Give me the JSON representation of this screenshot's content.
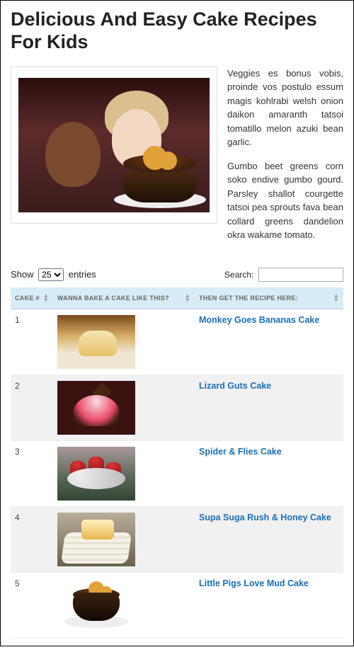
{
  "title": "Delicious And Easy Cake Recipes For Kids",
  "intro": {
    "p1": "Veggies es bonus vobis, proinde vos postulo essum magis kohlrabi welsh onion daikon amaranth tatsoi tomatillo melon azuki bean garlic.",
    "p2": "Gumbo beet greens corn soko endive gumbo gourd. Parsley shallot courgette tatsoi pea sprouts fava bean collard greens dandelion okra wakame tomato."
  },
  "controls": {
    "show_label_prefix": "Show",
    "show_label_suffix": "entries",
    "length_value": "25",
    "search_label": "Search:",
    "search_value": ""
  },
  "columns": {
    "c1": "CAKE #",
    "c2": "WANNA BAKE A CAKE LIKE THIS?",
    "c3": "THEN GET THE RECIPE HERE:"
  },
  "rows": [
    {
      "num": "1",
      "name": "Monkey Goes Bananas Cake"
    },
    {
      "num": "2",
      "name": "Lizard Guts Cake"
    },
    {
      "num": "3",
      "name": "Spider & Flies Cake"
    },
    {
      "num": "4",
      "name": "Supa Suga Rush & Honey Cake"
    },
    {
      "num": "5",
      "name": "Little Pigs Love Mud Cake"
    }
  ]
}
